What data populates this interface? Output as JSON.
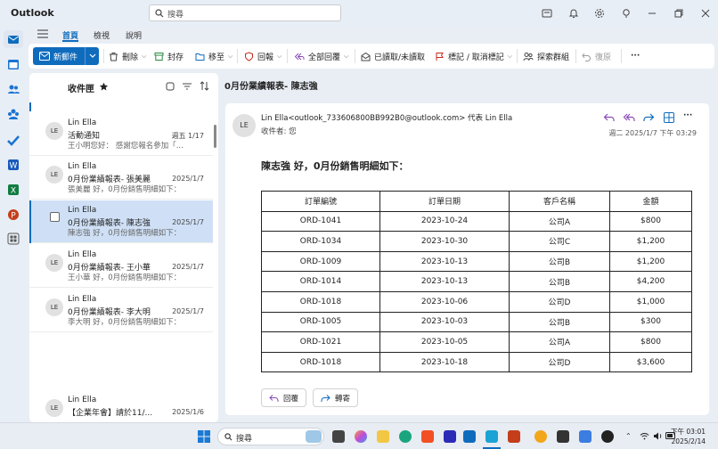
{
  "app": {
    "title": "Outlook",
    "search_placeholder": "搜尋"
  },
  "tabs": [
    {
      "label": "首頁"
    },
    {
      "label": "檢視"
    },
    {
      "label": "說明"
    }
  ],
  "ribbon": {
    "new_mail": "新郵件",
    "delete": "刪除",
    "archive": "封存",
    "move": "移至",
    "report": "回報",
    "reply_all": "全部回覆",
    "read_unread": "已讀取/未讀取",
    "flag": "標記 / 取消標記",
    "discover_groups": "探索群組",
    "undo": "復原"
  },
  "list": {
    "folder": "收件匣",
    "messages": [
      {
        "sender": "Lin Ella",
        "subject": "活動通知",
        "preview": "王小明您好： 感謝您報名參加「...",
        "date": "週五 1/17"
      },
      {
        "sender": "Lin Ella",
        "subject": "0月份業績報表- 張美麗",
        "preview": "張美麗 好，0月份銷售明細如下：",
        "date": "2025/1/7"
      },
      {
        "sender": "Lin Ella",
        "subject": "0月份業績報表- 陳志強",
        "preview": "陳志強 好，0月份銷售明細如下：",
        "date": "2025/1/7"
      },
      {
        "sender": "Lin Ella",
        "subject": "0月份業績報表- 王小華",
        "preview": "王小華 好，0月份銷售明細如下：",
        "date": "2025/1/7"
      },
      {
        "sender": "Lin Ella",
        "subject": "0月份業績報表- 李大明",
        "preview": "李大明 好，0月份銷售明細如下：",
        "date": "2025/1/7"
      },
      {
        "sender": "Lin Ella",
        "subject": "【企業年會】請於11/...",
        "preview": "",
        "date": "2025/1/6"
      }
    ]
  },
  "reading": {
    "title": "0月份業績報表- 陳志強",
    "avatar": "LE",
    "from": "Lin Ella<outlook_733606800BB992B0@outlook.com> 代表 Lin Ella",
    "to": "收件者:  您",
    "date": "週二 2025/1/7 下午 03:29",
    "greeting": "陳志強 好，0月份銷售明細如下：",
    "table": {
      "headers": [
        "訂單編號",
        "訂單日期",
        "客戶名稱",
        "金額"
      ],
      "rows": [
        [
          "ORD-1041",
          "2023-10-24",
          "公司A",
          "$800"
        ],
        [
          "ORD-1034",
          "2023-10-30",
          "公司C",
          "$1,200"
        ],
        [
          "ORD-1009",
          "2023-10-13",
          "公司B",
          "$1,200"
        ],
        [
          "ORD-1014",
          "2023-10-13",
          "公司B",
          "$4,200"
        ],
        [
          "ORD-1018",
          "2023-10-06",
          "公司D",
          "$1,000"
        ],
        [
          "ORD-1005",
          "2023-10-03",
          "公司B",
          "$300"
        ],
        [
          "ORD-1021",
          "2023-10-05",
          "公司A",
          "$800"
        ],
        [
          "ORD-1018",
          "2023-10-18",
          "公司D",
          "$3,600"
        ]
      ]
    },
    "reply": "回覆",
    "forward": "轉寄"
  },
  "taskbar": {
    "search": "搜尋",
    "time": "下午 03:01",
    "date": "2025/2/14"
  },
  "colors": {
    "accent": "#0f6cbd",
    "selected": "#cfe0f6"
  }
}
